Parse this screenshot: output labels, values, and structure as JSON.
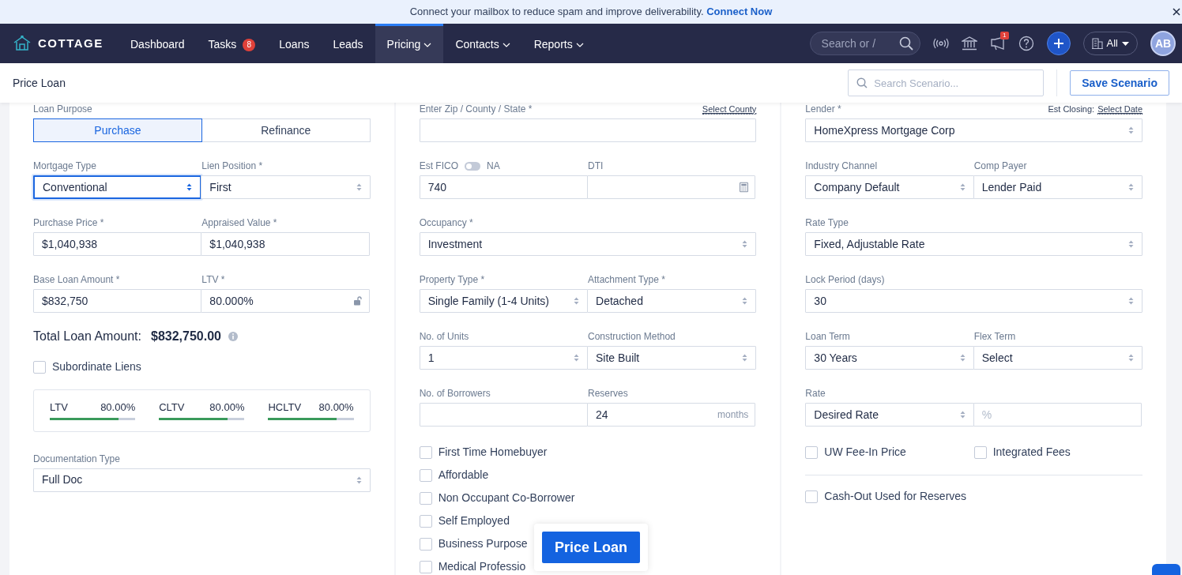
{
  "banner": {
    "text": "Connect your mailbox to reduce spam and improve deliverability.",
    "link": "Connect Now"
  },
  "navbar": {
    "logo": "COTTAGE",
    "items": [
      {
        "label": "Dashboard",
        "dropdown": false,
        "selected": false
      },
      {
        "label": "Tasks",
        "badge": "8",
        "dropdown": false,
        "selected": false
      },
      {
        "label": "Loans",
        "dropdown": false,
        "selected": false
      },
      {
        "label": "Leads",
        "dropdown": false,
        "selected": false
      },
      {
        "label": "Pricing",
        "dropdown": true,
        "selected": true
      },
      {
        "label": "Contacts",
        "dropdown": true,
        "selected": false
      },
      {
        "label": "Reports",
        "dropdown": true,
        "selected": false
      }
    ],
    "search": {
      "placeholder": "Search or /"
    },
    "notification_badge": "1",
    "scope": "All",
    "avatar": "AB"
  },
  "header": {
    "title": "Price Loan",
    "search": {
      "placeholder": "Search Scenario..."
    },
    "save_button": "Save Scenario"
  },
  "columns": [
    {
      "rows": [
        {
          "kind": "segmented",
          "label": "Loan Purpose",
          "options": [
            {
              "label": "Purchase",
              "selected": true
            },
            {
              "label": "Refinance",
              "selected": false
            }
          ]
        },
        {
          "kind": "fields",
          "fields": [
            {
              "kind": "select",
              "label": "Mortgage Type",
              "value": "Conventional",
              "focused": true
            },
            {
              "kind": "select",
              "label": "Lien Position *",
              "value": "First",
              "focused": false
            }
          ]
        },
        {
          "kind": "fields",
          "fields": [
            {
              "kind": "input",
              "label": "Purchase Price *",
              "value": "$1,040,938"
            },
            {
              "kind": "input",
              "label": "Appraised Value *",
              "value": "$1,040,938"
            }
          ]
        },
        {
          "kind": "fields",
          "fields": [
            {
              "kind": "input",
              "label": "Base Loan Amount *",
              "value": "$832,750"
            },
            {
              "kind": "lock_input",
              "label": "LTV *",
              "value": "80.000%"
            }
          ]
        },
        {
          "kind": "total",
          "label": "Total Loan Amount:",
          "value": "$832,750.00"
        },
        {
          "kind": "checkboxes",
          "items": [
            {
              "label": "Subordinate Liens",
              "checked": false
            }
          ]
        },
        {
          "kind": "ratios",
          "items": [
            {
              "label": "LTV",
              "value": "80.00%",
              "level": 0.8
            },
            {
              "label": "CLTV",
              "value": "80.00%",
              "level": 0.8
            },
            {
              "label": "HCLTV",
              "value": "80.00%",
              "level": 0.8
            }
          ]
        },
        {
          "kind": "fields",
          "fields": [
            {
              "kind": "select",
              "label": "Documentation Type",
              "value": "Full Doc",
              "focused": false
            }
          ]
        }
      ]
    },
    {
      "rows": [
        {
          "kind": "fields",
          "fields": [
            {
              "kind": "input",
              "label": "Enter Zip / County / State *",
              "link": "Select County"
            }
          ]
        },
        {
          "kind": "fields",
          "fields": [
            {
              "kind": "input",
              "label": "Est FICO",
              "toggle": {
                "label": "NA",
                "on": false
              },
              "value": "740"
            },
            {
              "kind": "calc_input",
              "label": "DTI"
            }
          ]
        },
        {
          "kind": "fields",
          "fields": [
            {
              "kind": "select",
              "label": "Occupancy *",
              "value": "Investment",
              "focused": false
            }
          ]
        },
        {
          "kind": "fields",
          "fields": [
            {
              "kind": "select",
              "label": "Property Type *",
              "value": "Single Family (1-4 Units)",
              "focused": false
            },
            {
              "kind": "select",
              "label": "Attachment Type *",
              "value": "Detached",
              "focused": false
            }
          ]
        },
        {
          "kind": "fields",
          "fields": [
            {
              "kind": "select",
              "label": "No. of Units",
              "value": "1",
              "focused": false
            },
            {
              "kind": "select",
              "label": "Construction Method",
              "value": "Site Built",
              "focused": false
            }
          ]
        },
        {
          "kind": "fields",
          "fields": [
            {
              "kind": "input",
              "label": "No. of Borrowers"
            },
            {
              "kind": "input",
              "label": "Reserves",
              "value": "24",
              "suffix": "months"
            }
          ]
        },
        {
          "kind": "checklist",
          "items": [
            {
              "label": "First Time Homebuyer",
              "checked": false
            },
            {
              "label": "Affordable",
              "checked": false
            },
            {
              "label": "Non Occupant Co-Borrower",
              "checked": false
            },
            {
              "label": "Self Employed",
              "checked": false
            },
            {
              "label": "Business Purpose",
              "checked": false
            },
            {
              "label": "Medical Professio",
              "checked": false
            }
          ]
        }
      ]
    },
    {
      "rows": [
        {
          "kind": "fields",
          "fields": [
            {
              "kind": "select",
              "label": "Lender *",
              "aside": "Est Closing:",
              "link": "Select Date",
              "value": "HomeXpress Mortgage Corp",
              "focused": false
            }
          ]
        },
        {
          "kind": "fields",
          "fields": [
            {
              "kind": "select",
              "label": "Industry Channel",
              "value": "Company Default",
              "focused": false
            },
            {
              "kind": "select",
              "label": "Comp Payer",
              "value": "Lender Paid",
              "focused": false
            }
          ]
        },
        {
          "kind": "fields",
          "fields": [
            {
              "kind": "select",
              "label": "Rate Type",
              "value": "Fixed, Adjustable Rate",
              "focused": false
            }
          ]
        },
        {
          "kind": "fields",
          "fields": [
            {
              "kind": "select",
              "label": "Lock Period (days)",
              "value": "30",
              "focused": false
            }
          ]
        },
        {
          "kind": "fields",
          "fields": [
            {
              "kind": "select",
              "label": "Loan Term",
              "value": "30 Years",
              "focused": false
            },
            {
              "kind": "select",
              "label": "Flex Term",
              "value": "Select",
              "focused": false
            }
          ]
        },
        {
          "kind": "fields",
          "fields": [
            {
              "kind": "select",
              "label": "Rate",
              "value": "Desired Rate",
              "focused": false
            },
            {
              "kind": "input",
              "placeholder": "%"
            }
          ]
        },
        {
          "kind": "checkboxes",
          "items": [
            {
              "label": "UW Fee-In Price",
              "checked": false
            },
            {
              "label": "Integrated Fees",
              "checked": false
            }
          ]
        },
        {
          "kind": "checkboxes",
          "divider_before": true,
          "items": [
            {
              "label": "Cash-Out Used for Reserves",
              "checked": false
            }
          ]
        }
      ]
    }
  ],
  "price_button": "Price Loan"
}
